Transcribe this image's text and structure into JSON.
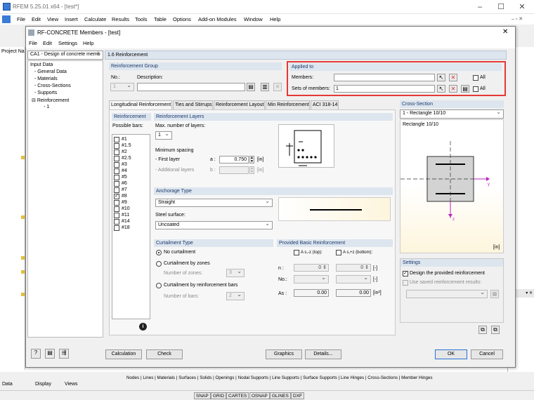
{
  "outer": {
    "title": "RFEM 5.25.01 x64 - [test*]",
    "menu": [
      "File",
      "Edit",
      "View",
      "Insert",
      "Calculate",
      "Results",
      "Tools",
      "Table",
      "Options",
      "Add-on Modules",
      "Window",
      "Help"
    ],
    "project_nav": "Project Na",
    "bottom_tabs": [
      "Data",
      "Display",
      "Views"
    ],
    "result_tabs": "Nodes | Lines | Materials | Surfaces | Solids | Openings | Nodal Supports | Line Supports | Surface Supports | Line Hinges | Cross-Sections | Member Hinges",
    "status": [
      "SNAP",
      "GRID",
      "CARTES",
      "OSNAP",
      "GLINES",
      "DXF"
    ]
  },
  "dialog": {
    "title": "RF-CONCRETE Members - [test]",
    "menu": [
      "File",
      "Edit",
      "Settings",
      "Help"
    ],
    "case_select": "CA1 - Design of concrete memb",
    "section_title": "1.6 Reinforcement",
    "nav": {
      "root": "Input Data",
      "items": [
        "General Data",
        "Materials",
        "Cross-Sections",
        "Supports",
        "Reinforcement"
      ],
      "sub": "1"
    },
    "group": {
      "header": "Reinforcement Group",
      "no_label": "No.:",
      "no_value": "1",
      "desc_label": "Description:",
      "desc_value": ""
    },
    "applied": {
      "header": "Applied to",
      "members_label": "Members:",
      "members_value": "",
      "sets_label": "Sets of members:",
      "sets_value": "1",
      "all": "All"
    },
    "tabs": [
      "Longitudinal Reinforcement",
      "Ties and Stirrups",
      "Reinforcement Layout",
      "Min Reinforcement",
      "ACI 318-14"
    ],
    "reinf": {
      "header": "Reinforcement",
      "possible": "Possible bars:",
      "bars": [
        "#1",
        "#1.5",
        "#2",
        "#2.5",
        "#3",
        "#4",
        "#5",
        "#6",
        "#7",
        "#8",
        "#9",
        "#10",
        "#11",
        "#14",
        "#18"
      ],
      "checked_index": 9
    },
    "layers": {
      "header": "Reinforcement Layers",
      "max_label": "Max. number of layers:",
      "max_value": "1",
      "min_spacing": "Minimum spacing",
      "first_label": "- First layer",
      "first_sym": "a :",
      "first_value": "0.750",
      "first_unit": "[in]",
      "add_label": "- Additional layers",
      "add_sym": "b :",
      "add_value": "",
      "add_unit": "[in]"
    },
    "anchorage": {
      "header": "Anchorage Type",
      "type_value": "Straight",
      "steel_label": "Steel surface:",
      "steel_value": "Uncoated"
    },
    "curtail": {
      "header": "Curtailment Type",
      "opt1": "No curtailment",
      "opt2": "Curtailment by zones",
      "zones_label": "Number of zones:",
      "zones_value": "3",
      "opt3": "Curtailment by reinforcement bars",
      "bars_label": "Number of bars:",
      "bars_value": "2"
    },
    "basic": {
      "header": "Provided Basic Reinforcement",
      "top_label": "A s,-z (top):",
      "bot_label": "A s,+z (bottom):",
      "n_label": "n :",
      "n_top": "0",
      "n_bot": "0",
      "n_unit": "[-]",
      "no_label": "No.:",
      "no_unit": "[-]",
      "as_label": "As :",
      "as_top": "0.00",
      "as_bot": "0.00",
      "as_unit": "[in²]"
    },
    "cross": {
      "header": "Cross-Section",
      "select": "1 - Rectangle 10/10",
      "name": "Rectangle 10/10",
      "unit": "[in]",
      "y_axis": "y",
      "z_axis": "z"
    },
    "settings": {
      "header": "Settings",
      "design": "Design the provided reinforcement",
      "use_saved": "Use saved reinforcement results:"
    },
    "buttons": {
      "calculation": "Calculation",
      "check": "Check",
      "graphics": "Graphics",
      "details": "Details...",
      "ok": "OK",
      "cancel": "Cancel"
    }
  }
}
